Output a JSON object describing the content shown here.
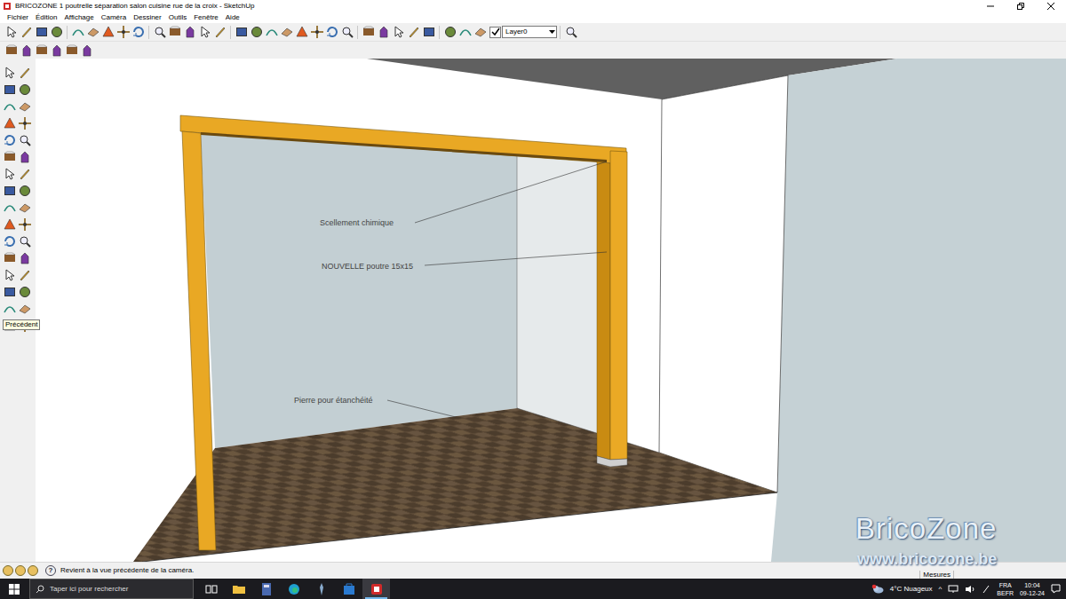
{
  "window": {
    "title": "BRICOZONE 1 poutrelle séparation salon cuisine rue de la croix - SketchUp"
  },
  "menu": [
    "Fichier",
    "Édition",
    "Affichage",
    "Caméra",
    "Dessiner",
    "Outils",
    "Fenêtre",
    "Aide"
  ],
  "layer_selector": {
    "value": "Layer0",
    "visible": true
  },
  "tooltip": {
    "text": "Précédent"
  },
  "annotations": [
    {
      "text": "Scellement chimique"
    },
    {
      "text": "NOUVELLE poutre 15x15"
    },
    {
      "text": "Pierre pour étanchéité"
    }
  ],
  "watermark": {
    "title": "BricoZone",
    "url": "www.bricozone.be"
  },
  "status_bar": {
    "help_icon": "?",
    "message": "Revient à la vue précédente de la caméra.",
    "measurements_label": "Mesures"
  },
  "taskbar": {
    "search_placeholder": "Taper ici pour rechercher",
    "apps": [
      {
        "kind": "taskview",
        "selected": false
      },
      {
        "kind": "explorer",
        "selected": false
      },
      {
        "kind": "calculator",
        "selected": false
      },
      {
        "kind": "edge",
        "selected": false
      },
      {
        "kind": "app",
        "selected": false
      },
      {
        "kind": "store",
        "selected": false
      },
      {
        "kind": "sketchup",
        "selected": true
      }
    ],
    "weather": "4°C Nuageux",
    "tray_arrow": "^",
    "language": "FRA",
    "layout": "BEFR",
    "time": "10:04",
    "date": "09-12-24"
  }
}
